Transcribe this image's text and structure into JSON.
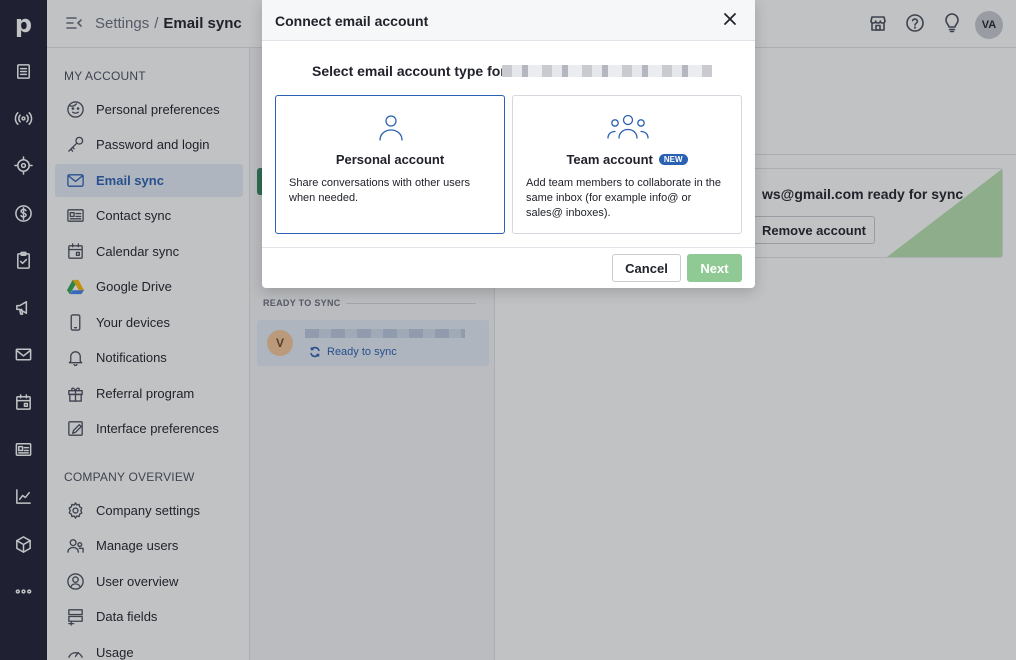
{
  "header": {
    "breadcrumb_root": "Settings",
    "breadcrumb_separator": "/",
    "breadcrumb_current": "Email sync",
    "avatar_initials": "VA"
  },
  "rail": {
    "logo": "p",
    "icons": [
      "deals-icon",
      "leads-icon",
      "target-icon",
      "dollar-icon",
      "tasks-icon",
      "campaigns-icon",
      "mail-icon",
      "calendar-icon",
      "contacts-icon",
      "insights-icon",
      "products-icon",
      "more-icon"
    ]
  },
  "sidebar": {
    "my_account_title": "MY ACCOUNT",
    "company_title": "COMPANY OVERVIEW",
    "my_account_items": [
      {
        "label": "Personal preferences",
        "icon": "face-icon"
      },
      {
        "label": "Password and login",
        "icon": "key-icon"
      },
      {
        "label": "Email sync",
        "icon": "envelope-icon"
      },
      {
        "label": "Contact sync",
        "icon": "contact-card-icon"
      },
      {
        "label": "Calendar sync",
        "icon": "calendar-icon"
      },
      {
        "label": "Google Drive",
        "icon": "google-drive-icon"
      },
      {
        "label": "Your devices",
        "icon": "phone-icon"
      },
      {
        "label": "Notifications",
        "icon": "bell-icon"
      },
      {
        "label": "Referral program",
        "icon": "gift-icon"
      },
      {
        "label": "Interface preferences",
        "icon": "pencil-box-icon"
      }
    ],
    "company_items": [
      {
        "label": "Company settings",
        "icon": "gear-icon"
      },
      {
        "label": "Manage users",
        "icon": "users-icon"
      },
      {
        "label": "User overview",
        "icon": "user-circle-icon"
      },
      {
        "label": "Data fields",
        "icon": "data-fields-icon"
      },
      {
        "label": "Usage",
        "icon": "gauge-icon"
      }
    ]
  },
  "middle": {
    "ready_to_sync_heading": "READY TO SYNC",
    "account_avatar": "V",
    "account_status": "Ready to sync"
  },
  "main": {
    "card_title_fragment": "ws@gmail.com ready for sync",
    "remove_button": "Remove account"
  },
  "modal": {
    "title": "Connect email account",
    "select_label": "Select email account type for",
    "personal": {
      "title": "Personal account",
      "description": "Share conversations with other users when needed."
    },
    "team": {
      "title": "Team account",
      "badge": "NEW",
      "description": "Add team members to collaborate in the same inbox (for example info@ or sales@ inboxes)."
    },
    "cancel": "Cancel",
    "next": "Next"
  },
  "colors": {
    "rail_bg": "#1f2136",
    "accent_blue": "#2b61b3",
    "active_bg": "#e5eef8",
    "next_disabled": "#8fc994",
    "sync_green": "#368764"
  }
}
